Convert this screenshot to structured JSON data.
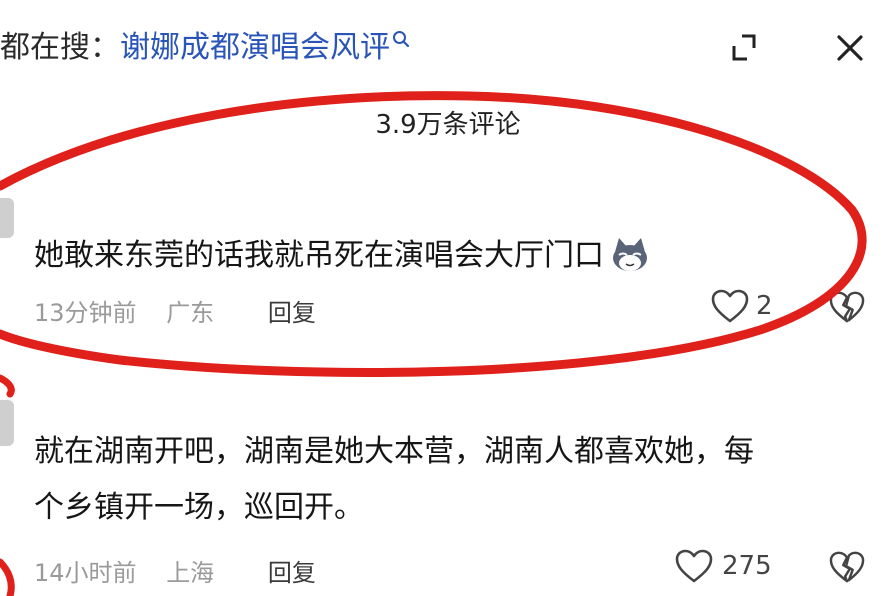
{
  "header": {
    "prefix": "都在搜：",
    "query": "谢娜成都演唱会风评"
  },
  "comment_count": "3.9万条评论",
  "comments": [
    {
      "text": "她敢来东莞的话我就吊死在演唱会大厅门口",
      "emoji_icon": "cat-face-icon",
      "time": "13分钟前",
      "region": "广东",
      "reply": "回复",
      "likes": "2"
    },
    {
      "text_line1": "就在湖南开吧，湖南是她大本营，湖南人都喜欢她，每",
      "text_line2": "个乡镇开一场，巡回开。",
      "time": "14小时前",
      "region": "上海",
      "reply": "回复",
      "likes": "275"
    }
  ],
  "colors": {
    "query": "#2a55b8",
    "annotation": "#e0201a",
    "meta": "#9a9a9a"
  }
}
